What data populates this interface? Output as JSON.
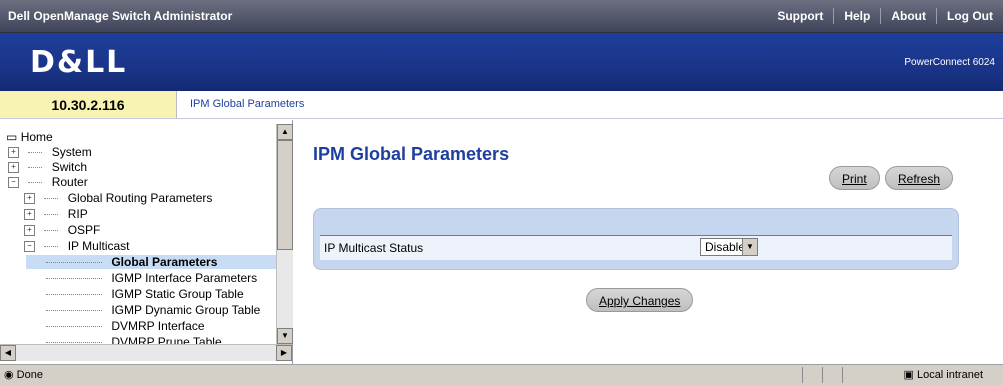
{
  "topbar": {
    "title": "Dell OpenManage Switch Administrator",
    "links": [
      "Support",
      "Help",
      "About",
      "Log Out"
    ]
  },
  "banner": {
    "logo": "D&LL",
    "model": "PowerConnect 6024"
  },
  "ip": "10.30.2.116",
  "breadcrumb": "IPM Global Parameters",
  "tree": {
    "items": [
      {
        "label": "Home",
        "level": 0,
        "type": "root"
      },
      {
        "label": "System",
        "level": 1,
        "type": "plus"
      },
      {
        "label": "Switch",
        "level": 1,
        "type": "plus"
      },
      {
        "label": "Router",
        "level": 1,
        "type": "minus"
      },
      {
        "label": "Global Routing Parameters",
        "level": 2,
        "type": "plus"
      },
      {
        "label": "RIP",
        "level": 2,
        "type": "plus"
      },
      {
        "label": "OSPF",
        "level": 2,
        "type": "plus"
      },
      {
        "label": "IP Multicast",
        "level": 2,
        "type": "minus"
      },
      {
        "label": "Global Parameters",
        "level": 3,
        "type": "leaf",
        "selected": true
      },
      {
        "label": "IGMP Interface Parameters",
        "level": 3,
        "type": "leaf"
      },
      {
        "label": "IGMP Static Group Table",
        "level": 3,
        "type": "leaf"
      },
      {
        "label": "IGMP Dynamic Group Table",
        "level": 3,
        "type": "leaf"
      },
      {
        "label": "DVMRP Interface",
        "level": 3,
        "type": "leaf"
      },
      {
        "label": "DVMRP Prune Table",
        "level": 3,
        "type": "leaf"
      }
    ]
  },
  "page": {
    "title": "IPM Global Parameters",
    "print_label": "Print",
    "refresh_label": "Refresh",
    "field_label": "IP Multicast Status",
    "field_value": "Disable",
    "apply_label": "Apply Changes"
  },
  "status": {
    "left": "Done",
    "right": "Local intranet"
  }
}
